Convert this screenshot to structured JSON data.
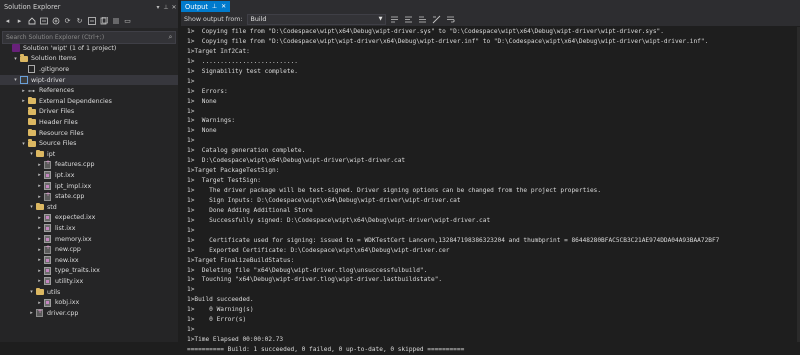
{
  "solution_explorer": {
    "title": "Solution Explorer",
    "search_placeholder": "Search Solution Explorer (Ctrl+;)",
    "tree": [
      {
        "label": "Solution 'wipt' (1 of 1 project)",
        "icon": "solution-icon",
        "depth": 0,
        "arrow": ""
      },
      {
        "label": "Solution Items",
        "icon": "folder-icon",
        "depth": 1,
        "arrow": "▾"
      },
      {
        "label": ".gitignore",
        "icon": "file-icon",
        "depth": 2,
        "arrow": ""
      },
      {
        "label": "wipt-driver",
        "icon": "project-icon",
        "depth": 1,
        "arrow": "▾",
        "selected": true
      },
      {
        "label": "References",
        "icon": "references-icon",
        "depth": 2,
        "arrow": "▸"
      },
      {
        "label": "External Dependencies",
        "icon": "folder-icon",
        "depth": 2,
        "arrow": "▸"
      },
      {
        "label": "Driver Files",
        "icon": "folder-icon",
        "depth": 2,
        "arrow": ""
      },
      {
        "label": "Header Files",
        "icon": "folder-icon",
        "depth": 2,
        "arrow": ""
      },
      {
        "label": "Resource Files",
        "icon": "folder-icon",
        "depth": 2,
        "arrow": ""
      },
      {
        "label": "Source Files",
        "icon": "folder-icon",
        "depth": 2,
        "arrow": "▾"
      },
      {
        "label": "ipt",
        "icon": "folder-icon",
        "depth": 3,
        "arrow": "▾"
      },
      {
        "label": "features.cpp",
        "icon": "cpp-icon",
        "depth": 4,
        "arrow": "▸"
      },
      {
        "label": "ipt.ixx",
        "icon": "ixx-icon",
        "depth": 4,
        "arrow": "▸"
      },
      {
        "label": "ipt_impl.ixx",
        "icon": "ixx-icon",
        "depth": 4,
        "arrow": "▸"
      },
      {
        "label": "state.cpp",
        "icon": "cpp-icon",
        "depth": 4,
        "arrow": "▸"
      },
      {
        "label": "std",
        "icon": "folder-icon",
        "depth": 3,
        "arrow": "▾"
      },
      {
        "label": "expected.ixx",
        "icon": "ixx-icon",
        "depth": 4,
        "arrow": "▸"
      },
      {
        "label": "list.ixx",
        "icon": "ixx-icon",
        "depth": 4,
        "arrow": "▸"
      },
      {
        "label": "memory.ixx",
        "icon": "ixx-icon",
        "depth": 4,
        "arrow": "▸"
      },
      {
        "label": "new.cpp",
        "icon": "cpp-icon",
        "depth": 4,
        "arrow": "▸"
      },
      {
        "label": "new.ixx",
        "icon": "ixx-icon",
        "depth": 4,
        "arrow": "▸"
      },
      {
        "label": "type_traits.ixx",
        "icon": "ixx-icon",
        "depth": 4,
        "arrow": "▸"
      },
      {
        "label": "utility.ixx",
        "icon": "ixx-icon",
        "depth": 4,
        "arrow": "▸"
      },
      {
        "label": "utils",
        "icon": "folder-icon",
        "depth": 3,
        "arrow": "▾"
      },
      {
        "label": "kobj.ixx",
        "icon": "ixx-icon",
        "depth": 4,
        "arrow": "▸"
      },
      {
        "label": "driver.cpp",
        "icon": "cpp-icon",
        "depth": 3,
        "arrow": "▸"
      }
    ]
  },
  "output": {
    "tab_label": "Output",
    "show_output_from_label": "Show output from:",
    "source_value": "Build",
    "lines": [
      "1>  Copying file from \"D:\\Codespace\\wipt\\x64\\Debug\\wipt-driver.sys\" to \"D:\\Codespace\\wipt\\x64\\Debug\\wipt-driver\\wipt-driver.sys\".",
      "1>  Copying file from \"D:\\Codespace\\wipt\\wipt-driver\\x64\\Debug\\wipt-driver.inf\" to \"D:\\Codespace\\wipt\\x64\\Debug\\wipt-driver\\wipt-driver.inf\".",
      "1>Target Inf2Cat:",
      "1>  ..........................",
      "1>  Signability test complete.",
      "1>",
      "1>  Errors:",
      "1>  None",
      "1>",
      "1>  Warnings:",
      "1>  None",
      "1>",
      "1>  Catalog generation complete.",
      "1>  D:\\Codespace\\wipt\\x64\\Debug\\wipt-driver\\wipt-driver.cat",
      "1>Target PackageTestSign:",
      "1>  Target TestSign:",
      "1>    The driver package will be test-signed. Driver signing options can be changed from the project properties.",
      "1>    Sign Inputs: D:\\Codespace\\wipt\\x64\\Debug\\wipt-driver\\wipt-driver.cat",
      "1>    Done Adding Additional Store",
      "1>    Successfully signed: D:\\Codespace\\wipt\\x64\\Debug\\wipt-driver\\wipt-driver.cat",
      "1>",
      "1>    Certificate used for signing: issued to = WDKTestCert Lancern,132847198386323204 and thumbprint = 86448280BFAC5CB3C21AE974DDA04A93BAA72BF7",
      "1>    Exported Certificate: D:\\Codespace\\wipt\\x64\\Debug\\wipt-driver.cer",
      "1>Target FinalizeBuildStatus:",
      "1>  Deleting file \"x64\\Debug\\wipt-driver.tlog\\unsuccessfulbuild\".",
      "1>  Touching \"x64\\Debug\\wipt-driver.tlog\\wipt-driver.lastbuildstate\".",
      "1>",
      "1>Build succeeded.",
      "1>    0 Warning(s)",
      "1>    0 Error(s)",
      "1>",
      "1>Time Elapsed 00:00:02.73",
      "========== Build: 1 succeeded, 0 failed, 0 up-to-date, 0 skipped =========="
    ]
  },
  "colors": {
    "accent": "#007acc",
    "panel_bg": "#252526",
    "editor_bg": "#1e1e1e",
    "folder": "#dcb862"
  }
}
